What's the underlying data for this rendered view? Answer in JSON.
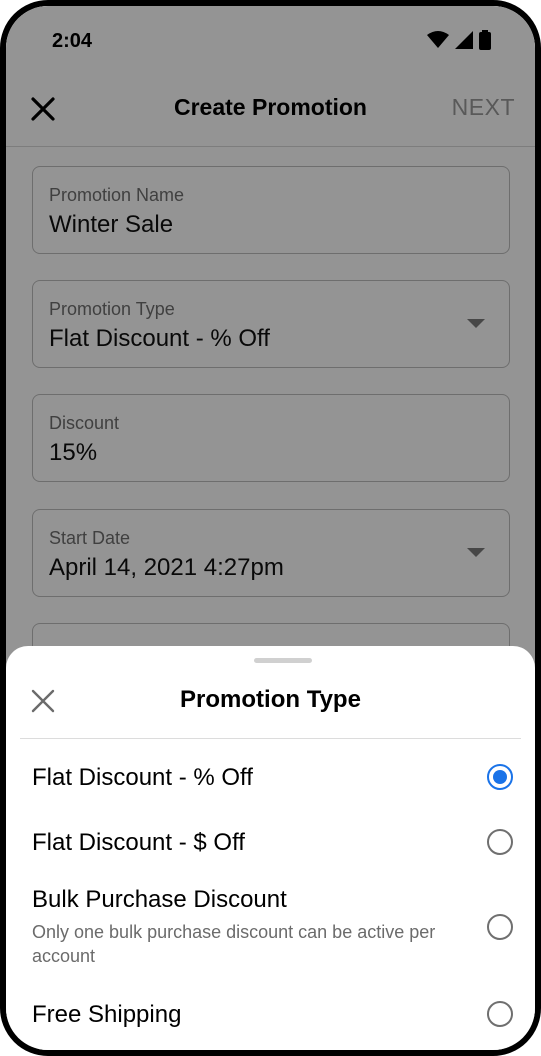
{
  "status_bar": {
    "time": "2:04"
  },
  "app_bar": {
    "title": "Create Promotion",
    "next_label": "NEXT"
  },
  "form": {
    "fields": [
      {
        "label": "Promotion Name",
        "value": "Winter Sale"
      },
      {
        "label": "Promotion Type",
        "value": "Flat Discount - % Off"
      },
      {
        "label": "Discount",
        "value": "15%"
      },
      {
        "label": "Start Date",
        "value": "April 14, 2021 4:27pm"
      }
    ]
  },
  "sheet": {
    "title": "Promotion Type",
    "options": [
      {
        "label": "Flat Discount - % Off",
        "description": "",
        "selected": true
      },
      {
        "label": "Flat Discount - $ Off",
        "description": "",
        "selected": false
      },
      {
        "label": "Bulk Purchase Discount",
        "description": "Only one bulk purchase discount can be active per account",
        "selected": false
      },
      {
        "label": "Free Shipping",
        "description": "",
        "selected": false
      }
    ]
  },
  "colors": {
    "accent": "#1a73e8",
    "scrim": "#000000"
  }
}
